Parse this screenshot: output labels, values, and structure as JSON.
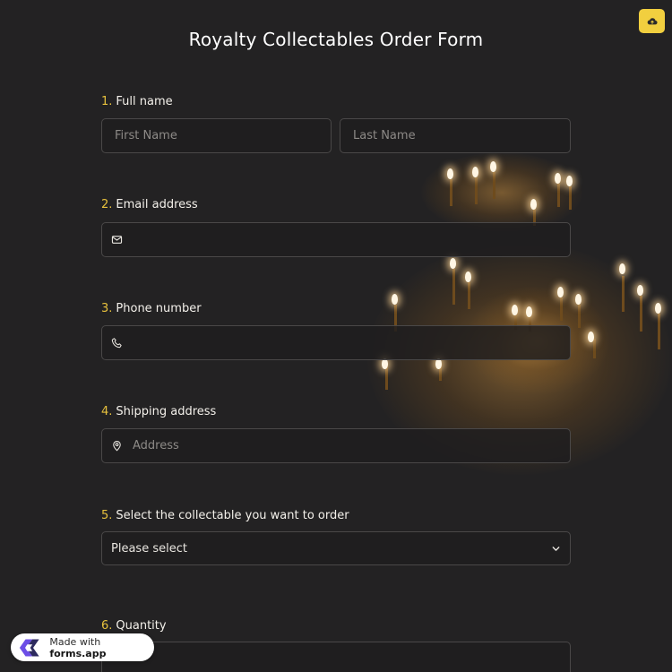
{
  "form": {
    "title": "Royalty Collectables Order Form"
  },
  "toolbar": {
    "upload_icon": "cloud-upload-icon"
  },
  "questions": [
    {
      "number": "1.",
      "label": "Full name",
      "fields": [
        {
          "placeholder": "First Name"
        },
        {
          "placeholder": "Last Name"
        }
      ]
    },
    {
      "number": "2.",
      "label": "Email address",
      "icon": "envelope-icon",
      "value": ""
    },
    {
      "number": "3.",
      "label": "Phone number",
      "icon": "phone-icon",
      "value": ""
    },
    {
      "number": "4.",
      "label": "Shipping address",
      "icon": "map-pin-icon",
      "placeholder": "Address"
    },
    {
      "number": "5.",
      "label": "Select the collectable you want to order",
      "selected": "Please select",
      "icon": "chevron-down-icon"
    },
    {
      "number": "6.",
      "label": "Quantity"
    }
  ],
  "badge": {
    "prefix": "Made with",
    "brand": "forms.app",
    "icon": "forms-app-logo-icon"
  },
  "colors": {
    "background": "#232223",
    "accent": "#f1cf3f",
    "number": "#e7c13d",
    "field_border": "#4a4848"
  }
}
